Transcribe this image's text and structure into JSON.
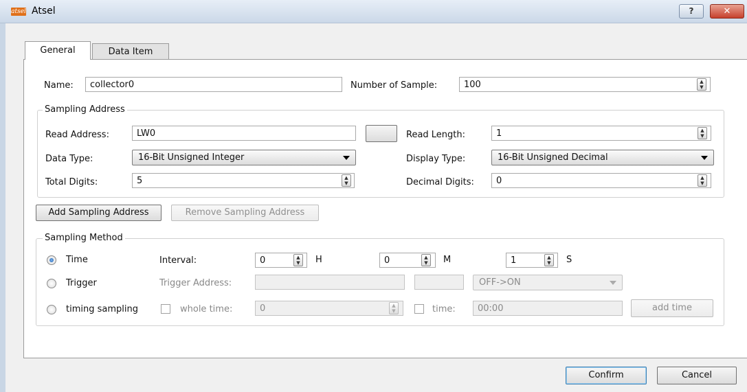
{
  "window": {
    "title": "Atsel",
    "logo_text": "atsel",
    "help_label": "?",
    "close_label": "✕"
  },
  "tabs": {
    "general": "General",
    "data_item": "Data Item"
  },
  "general": {
    "name_label": "Name:",
    "name_value": "collector0",
    "num_sample_label": "Number of Sample:",
    "num_sample_value": "100"
  },
  "sampling_address": {
    "title": "Sampling Address",
    "read_address_label": "Read Address:",
    "read_address_value": "LW0",
    "read_length_label": "Read Length:",
    "read_length_value": "1",
    "data_type_label": "Data Type:",
    "data_type_value": "16-Bit Unsigned Integer",
    "display_type_label": "Display Type:",
    "display_type_value": "16-Bit Unsigned Decimal",
    "total_digits_label": "Total Digits:",
    "total_digits_value": "5",
    "decimal_digits_label": "Decimal Digits:",
    "decimal_digits_value": "0"
  },
  "buttons": {
    "add_sampling": "Add Sampling Address",
    "remove_sampling": "Remove Sampling Address",
    "confirm": "Confirm",
    "cancel": "Cancel",
    "add_time": "add time"
  },
  "sampling_method": {
    "title": "Sampling Method",
    "time_label": "Time",
    "interval_label": "Interval:",
    "hours_value": "0",
    "hours_unit": "H",
    "minutes_value": "0",
    "minutes_unit": "M",
    "seconds_value": "1",
    "seconds_unit": "S",
    "trigger_label": "Trigger",
    "trigger_address_label": "Trigger Address:",
    "trigger_mode_value": "OFF->ON",
    "timing_label": "timing sampling",
    "whole_time_label": "whole time:",
    "whole_time_value": "0",
    "time_label_2": "time:",
    "time_value": "00:00",
    "selected": "Time"
  },
  "colors": {
    "title_bar": "#cbd8e8",
    "close_button": "#c6402c",
    "selected_radio": "#1f5fae"
  }
}
